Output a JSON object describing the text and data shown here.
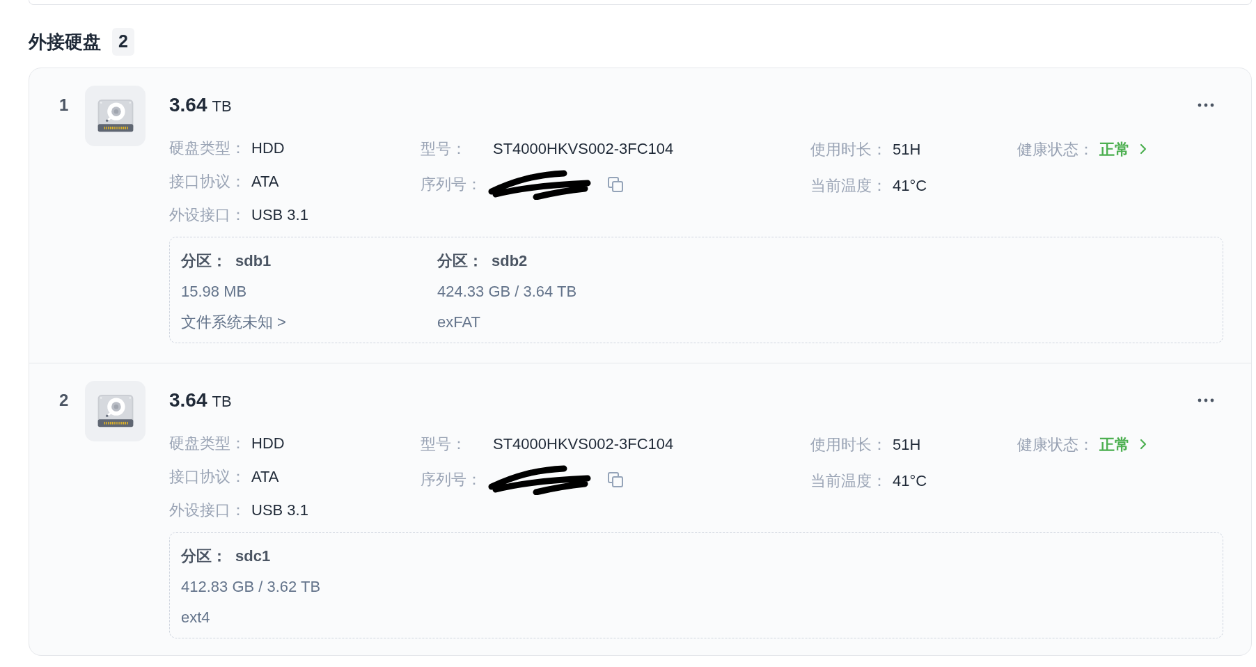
{
  "section": {
    "title": "外接硬盘",
    "count": "2"
  },
  "disks": [
    {
      "index": "1",
      "capacity": "3.64",
      "unit": "TB",
      "columns": [
        [
          {
            "kind": "text",
            "label": "硬盘类型：",
            "value": "HDD"
          },
          {
            "kind": "text",
            "label": "接口协议：",
            "value": "ATA"
          },
          {
            "kind": "text",
            "label": "外设接口：",
            "value": "USB 3.1"
          }
        ],
        [
          {
            "kind": "text",
            "label": "型号：",
            "value": "ST4000HKVS002-3FC104"
          },
          {
            "kind": "redacted",
            "label": "序列号："
          }
        ],
        [
          {
            "kind": "text",
            "label": "使用时长：",
            "value": "51H"
          },
          {
            "kind": "text",
            "label": "当前温度：",
            "value": "41°C"
          }
        ],
        [
          {
            "kind": "status",
            "label": "健康状态：",
            "value": "正常"
          }
        ]
      ],
      "partitions": [
        {
          "label": "分区：",
          "name": "sdb1",
          "size": "15.98 MB",
          "filesystem": "文件系统未知 >"
        },
        {
          "label": "分区：",
          "name": "sdb2",
          "size": "424.33 GB / 3.64 TB",
          "filesystem": "exFAT"
        }
      ]
    },
    {
      "index": "2",
      "capacity": "3.64",
      "unit": "TB",
      "columns": [
        [
          {
            "kind": "text",
            "label": "硬盘类型：",
            "value": "HDD"
          },
          {
            "kind": "text",
            "label": "接口协议：",
            "value": "ATA"
          },
          {
            "kind": "text",
            "label": "外设接口：",
            "value": "USB 3.1"
          }
        ],
        [
          {
            "kind": "text",
            "label": "型号：",
            "value": "ST4000HKVS002-3FC104"
          },
          {
            "kind": "redacted",
            "label": "序列号："
          }
        ],
        [
          {
            "kind": "text",
            "label": "使用时长：",
            "value": "51H"
          },
          {
            "kind": "text",
            "label": "当前温度：",
            "value": "41°C"
          }
        ],
        [
          {
            "kind": "status",
            "label": "健康状态：",
            "value": "正常"
          }
        ]
      ],
      "partitions": [
        {
          "label": "分区：",
          "name": "sdc1",
          "size": "412.83 GB / 3.62 TB",
          "filesystem": "ext4"
        }
      ]
    }
  ]
}
